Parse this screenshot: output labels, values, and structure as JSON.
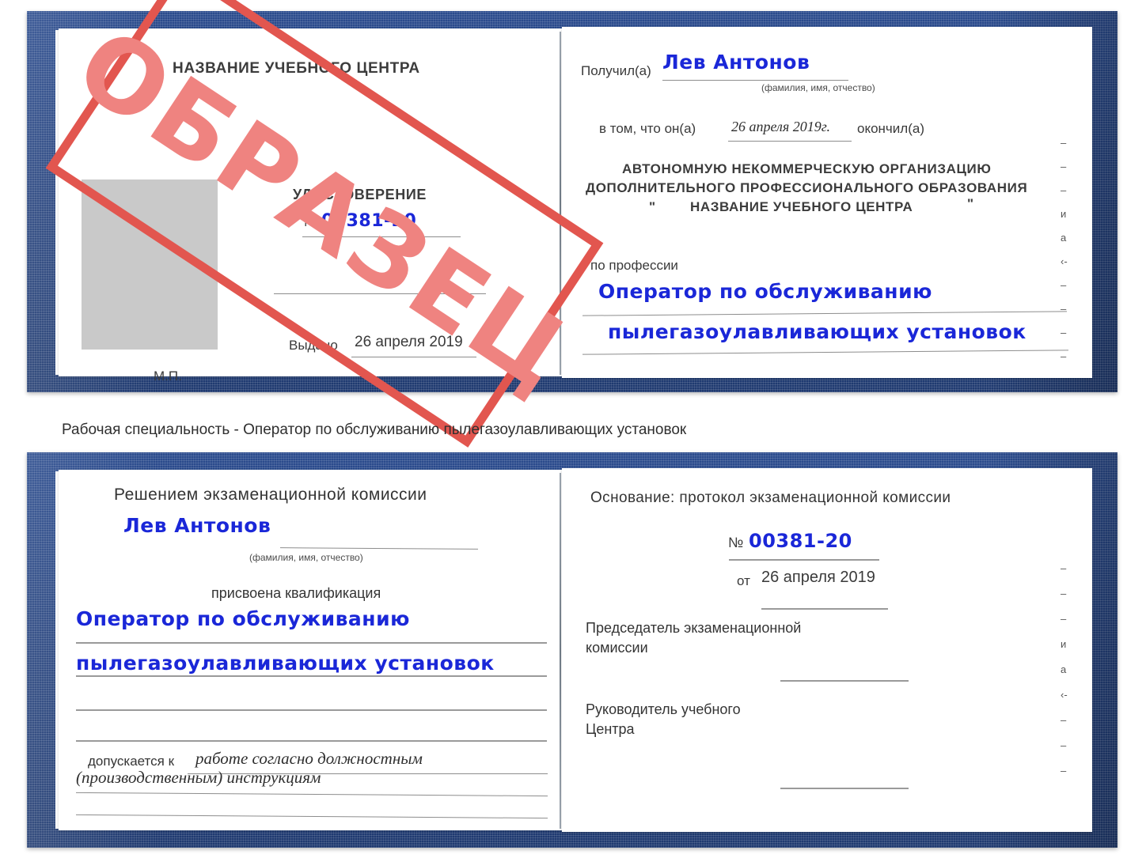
{
  "document": {
    "type": "Удостоверение",
    "watermark": "ОБРАЗЕЦ",
    "accent_blue_cover": "#2a4b8d",
    "handwriting_color": "#1a27d8",
    "watermark_color": "#e2564f"
  },
  "caption": "Рабочая специальность - Оператор по обслуживанию пылегазоулавливающих установок",
  "cert_top": {
    "left_page": {
      "org_title": "НАЗВАНИЕ УЧЕБНОГО ЦЕНТРА",
      "doc_title": "УДОСТОВЕРЕНИЕ",
      "number_label": "№",
      "number_value": "00381-20",
      "issued_label": "Выдано",
      "issued_value": "26 апреля 2019",
      "stamp_label": "М.П."
    },
    "right_page": {
      "received_label": "Получил(а)",
      "received_value": "Лев Антонов",
      "fio_hint": "(фамилия, имя, отчество)",
      "that_label": "в том, что он(а)",
      "that_value": "26 апреля 2019г.",
      "finished_label": "окончил(а)",
      "org_line1": "АВТОНОМНУЮ НЕКОММЕРЧЕСКУЮ ОРГАНИЗАЦИЮ",
      "org_line2": "ДОПОЛНИТЕЛЬНОГО ПРОФЕССИОНАЛЬНОГО ОБРАЗОВАНИЯ",
      "quote_open": "\"",
      "org_line3": "НАЗВАНИЕ УЧЕБНОГО ЦЕНТРА",
      "quote_close": "\"",
      "profession_label": "по профессии",
      "profession_line1": "Оператор по обслуживанию",
      "profession_line2": "пылегазоулавливающих установок"
    },
    "edge_marks": [
      "–",
      "–",
      "–",
      "и",
      "а",
      "‹-",
      "–",
      "–",
      "–",
      "–"
    ]
  },
  "cert_bottom": {
    "left_page": {
      "heading": "Решением экзаменационной комиссии",
      "name_value": "Лев Антонов",
      "fio_hint": "(фамилия, имя, отчество)",
      "qualification_label": "присвоена квалификация",
      "qualification_line1": "Оператор по обслуживанию",
      "qualification_line2": "пылегазоулавливающих установок",
      "allowed_label": "допускается к",
      "allowed_value_line1": "работе согласно должностным",
      "allowed_value_line2": "(производственным) инструкциям"
    },
    "right_page": {
      "basis_label": "Основание: протокол экзаменационной комиссии",
      "number_label": "№",
      "number_value": "00381-20",
      "date_label": "от",
      "date_value": "26 апреля 2019",
      "chairman_line1": "Председатель экзаменационной",
      "chairman_line2": "комиссии",
      "head_line1": "Руководитель учебного",
      "head_line2": "Центра"
    },
    "edge_marks": [
      "–",
      "–",
      "–",
      "и",
      "а",
      "‹-",
      "–",
      "–",
      "–"
    ]
  }
}
